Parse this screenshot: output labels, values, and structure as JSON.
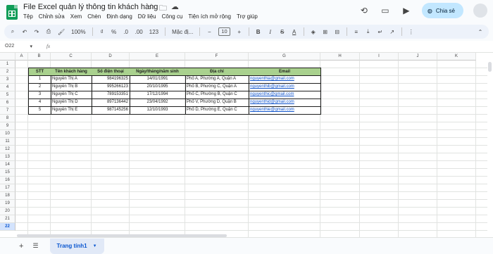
{
  "app": {
    "doc_title": "File Excel quản lý thông tin khách hàng",
    "menu": [
      "Tệp",
      "Chỉnh sửa",
      "Xem",
      "Chèn",
      "Định dạng",
      "Dữ liệu",
      "Công cụ",
      "Tiện ích mở rộng",
      "Trợ giúp"
    ],
    "share_label": "Chia sẻ"
  },
  "toolbar": {
    "zoom": "100%",
    "currency": "₫",
    "percent": "%",
    "dec_less": ".0",
    "dec_more": ".00",
    "number_fmt": "123",
    "font": "Mặc đị...",
    "font_size": "10"
  },
  "formula": {
    "cell_ref": "O22",
    "fx": "fx"
  },
  "columns": [
    "A",
    "B",
    "C",
    "D",
    "E",
    "F",
    "G",
    "H",
    "I",
    "J",
    "K"
  ],
  "rows": [
    "1",
    "2",
    "3",
    "4",
    "5",
    "6",
    "7",
    "8",
    "9",
    "10",
    "11",
    "12",
    "13",
    "14",
    "15",
    "16",
    "17",
    "18",
    "19",
    "20",
    "21",
    "22"
  ],
  "table": {
    "headers": [
      "STT",
      "Tên khách hàng",
      "Số điện thoại",
      "Ngày/tháng/năm sinh",
      "Địa chỉ",
      "Email"
    ],
    "rows": [
      [
        "1",
        "Nguyễn Thị A",
        "984196325",
        "14/01/1991",
        "Phố A, Phường A, Quận A",
        "nguyenthia@gmail.com"
      ],
      [
        "2",
        "Nguyễn Thị B",
        "995266123",
        "20/10/1995",
        "Phố B, Phường C, Quận A",
        "nguyenthib@gmail.com"
      ],
      [
        "3",
        "Nguyễn Thị C",
        "789153351",
        "17/12/1994",
        "Phố C, Phường B, Quận C",
        "nguyenthic@gmail.com"
      ],
      [
        "4",
        "Nguyễn Thị D",
        "897136442",
        "23/04/1992",
        "Phố V, Phường D, Quận B",
        "nguyenthid@gmail.com"
      ],
      [
        "5",
        "Nguyễn Thị E",
        "987145256",
        "12/10/1993",
        "Phố D, Phường E, Quận C",
        "nguyenthie@gmail.com"
      ]
    ]
  },
  "sheet_tab": "Trang tính1",
  "colors": {
    "header_fill": "#a9d18e",
    "link": "#1155cc",
    "share_bg": "#c2e7ff",
    "active_tab": "#0b57d0"
  }
}
